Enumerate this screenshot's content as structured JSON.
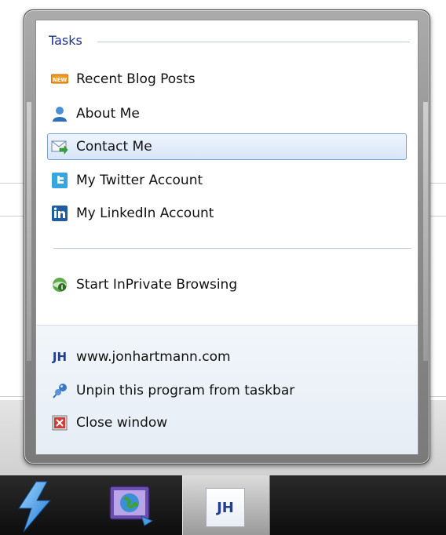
{
  "jump_list": {
    "tasks_title": "Tasks",
    "tasks": [
      {
        "label": "Recent Blog Posts",
        "icon": "new-badge-icon"
      },
      {
        "label": "About Me",
        "icon": "person-icon"
      },
      {
        "label": "Contact Me",
        "icon": "envelope-arrow-icon",
        "selected": true
      },
      {
        "label": "My Twitter Account",
        "icon": "twitter-icon"
      },
      {
        "label": "My LinkedIn Account",
        "icon": "linkedin-icon"
      }
    ],
    "private_item": {
      "label": "Start InPrivate Browsing",
      "icon": "inprivate-icon"
    },
    "footer": [
      {
        "label": "www.jonhartmann.com",
        "icon": "jh-logo-icon"
      },
      {
        "label": "Unpin this program from taskbar",
        "icon": "unpin-icon"
      },
      {
        "label": "Close window",
        "icon": "close-window-icon"
      }
    ],
    "new_badge_text": "NEW",
    "jh_icon_text": "JH"
  },
  "taskbar": {
    "items": [
      {
        "icon": "lightning-icon"
      },
      {
        "icon": "globe-monitor-icon"
      },
      {
        "icon": "jh-app-icon",
        "text": "JH",
        "active": true
      }
    ]
  },
  "colors": {
    "title": "#1e3287",
    "selection_border": "#7da2ce",
    "taskbar": "#0d0d0d"
  }
}
